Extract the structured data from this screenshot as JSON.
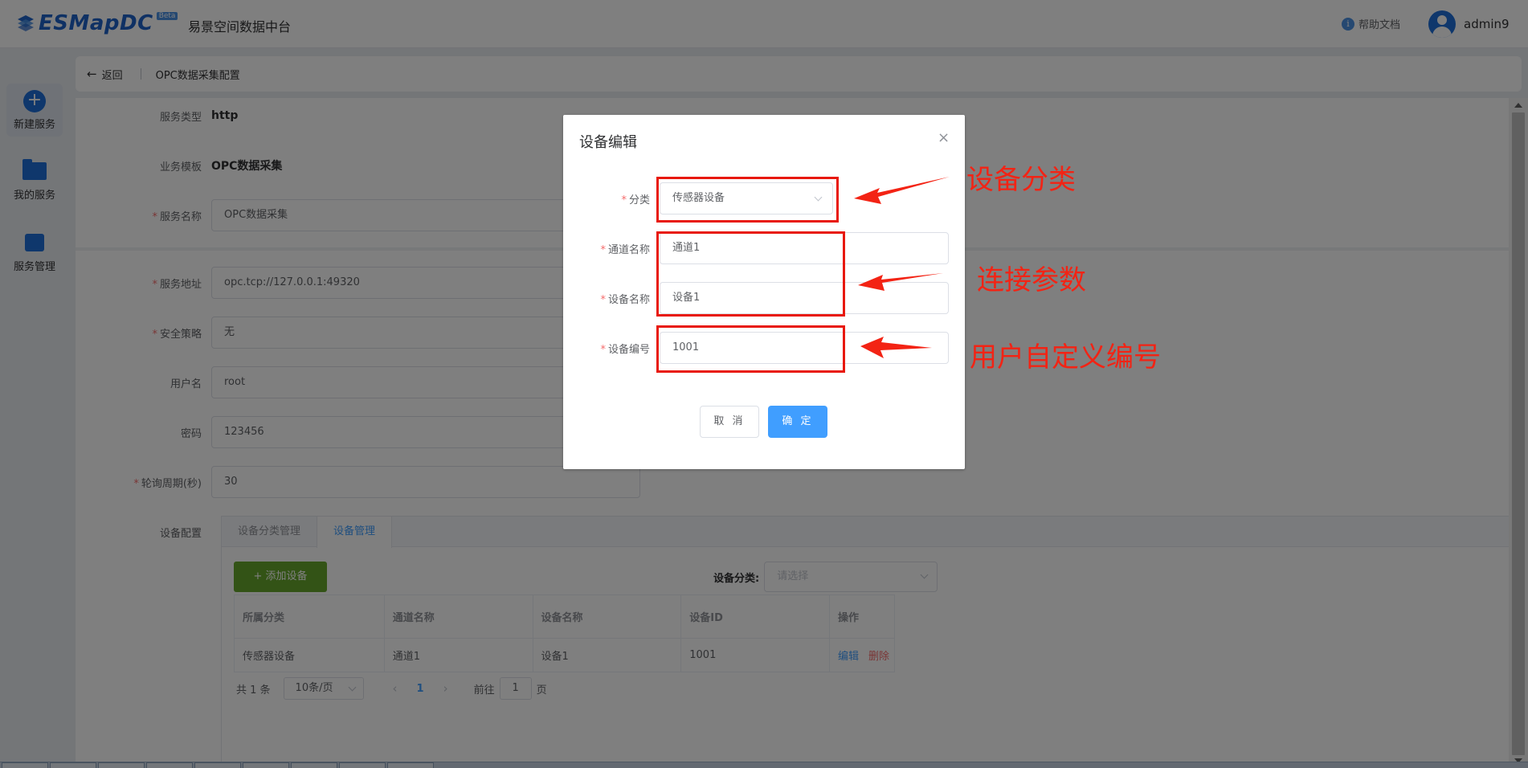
{
  "header": {
    "logo_text": "ESMapDC",
    "logo_badge": "Beta",
    "app_title": "易景空间数据中台",
    "help_label": "帮助文档",
    "username": "admin9"
  },
  "sidebar": {
    "items": [
      {
        "label": "新建服务",
        "icon": "plus-circle-icon"
      },
      {
        "label": "我的服务",
        "icon": "folder-icon"
      },
      {
        "label": "服务管理",
        "icon": "bookmark-icon"
      }
    ]
  },
  "breadcrumb": {
    "back_label": "返回",
    "title": "OPC数据采集配置"
  },
  "form": {
    "service_type_label": "服务类型",
    "service_type_value": "http",
    "template_label": "业务模板",
    "template_value": "OPC数据采集",
    "name_label": "服务名称",
    "name_value": "OPC数据采集",
    "address_label": "服务地址",
    "address_value": "opc.tcp://127.0.0.1:49320",
    "security_label": "安全策略",
    "security_value": "无",
    "username_label": "用户名",
    "username_value": "root",
    "password_label": "密码",
    "password_value": "123456",
    "poll_label": "轮询周期(秒)",
    "poll_value": "30",
    "device_config_label": "设备配置"
  },
  "device_config": {
    "tabs": [
      "设备分类管理",
      "设备管理"
    ],
    "add_button": "+ 添加设备",
    "filter_label": "设备分类:",
    "filter_placeholder": "请选择",
    "columns": [
      "所属分类",
      "通道名称",
      "设备名称",
      "设备ID",
      "操作"
    ],
    "rows": [
      {
        "category": "传感器设备",
        "channel": "通道1",
        "device": "设备1",
        "device_id": "1001",
        "edit": "编辑",
        "delete": "删除"
      }
    ],
    "pagination": {
      "total_text": "共 1 条",
      "page_size": "10条/页",
      "current_page": "1",
      "goto_label": "前往",
      "goto_value": "1",
      "page_suffix": "页"
    }
  },
  "dialog": {
    "title": "设备编辑",
    "close_glyph": "×",
    "category_label": "分类",
    "category_value": "传感器设备",
    "channel_label": "通道名称",
    "channel_value": "通道1",
    "device_name_label": "设备名称",
    "device_name_value": "设备1",
    "device_no_label": "设备编号",
    "device_no_value": "1001",
    "cancel_label": "取 消",
    "ok_label": "确 定"
  },
  "annotations": {
    "category_note": "设备分类",
    "connection_note": "连接参数",
    "custom_id_note": "用户自定义编号",
    "color": "#f32314"
  },
  "colors": {
    "primary": "#409eff",
    "brand": "#1e6fd8",
    "success": "#67a72d",
    "danger": "#f56c6c"
  }
}
